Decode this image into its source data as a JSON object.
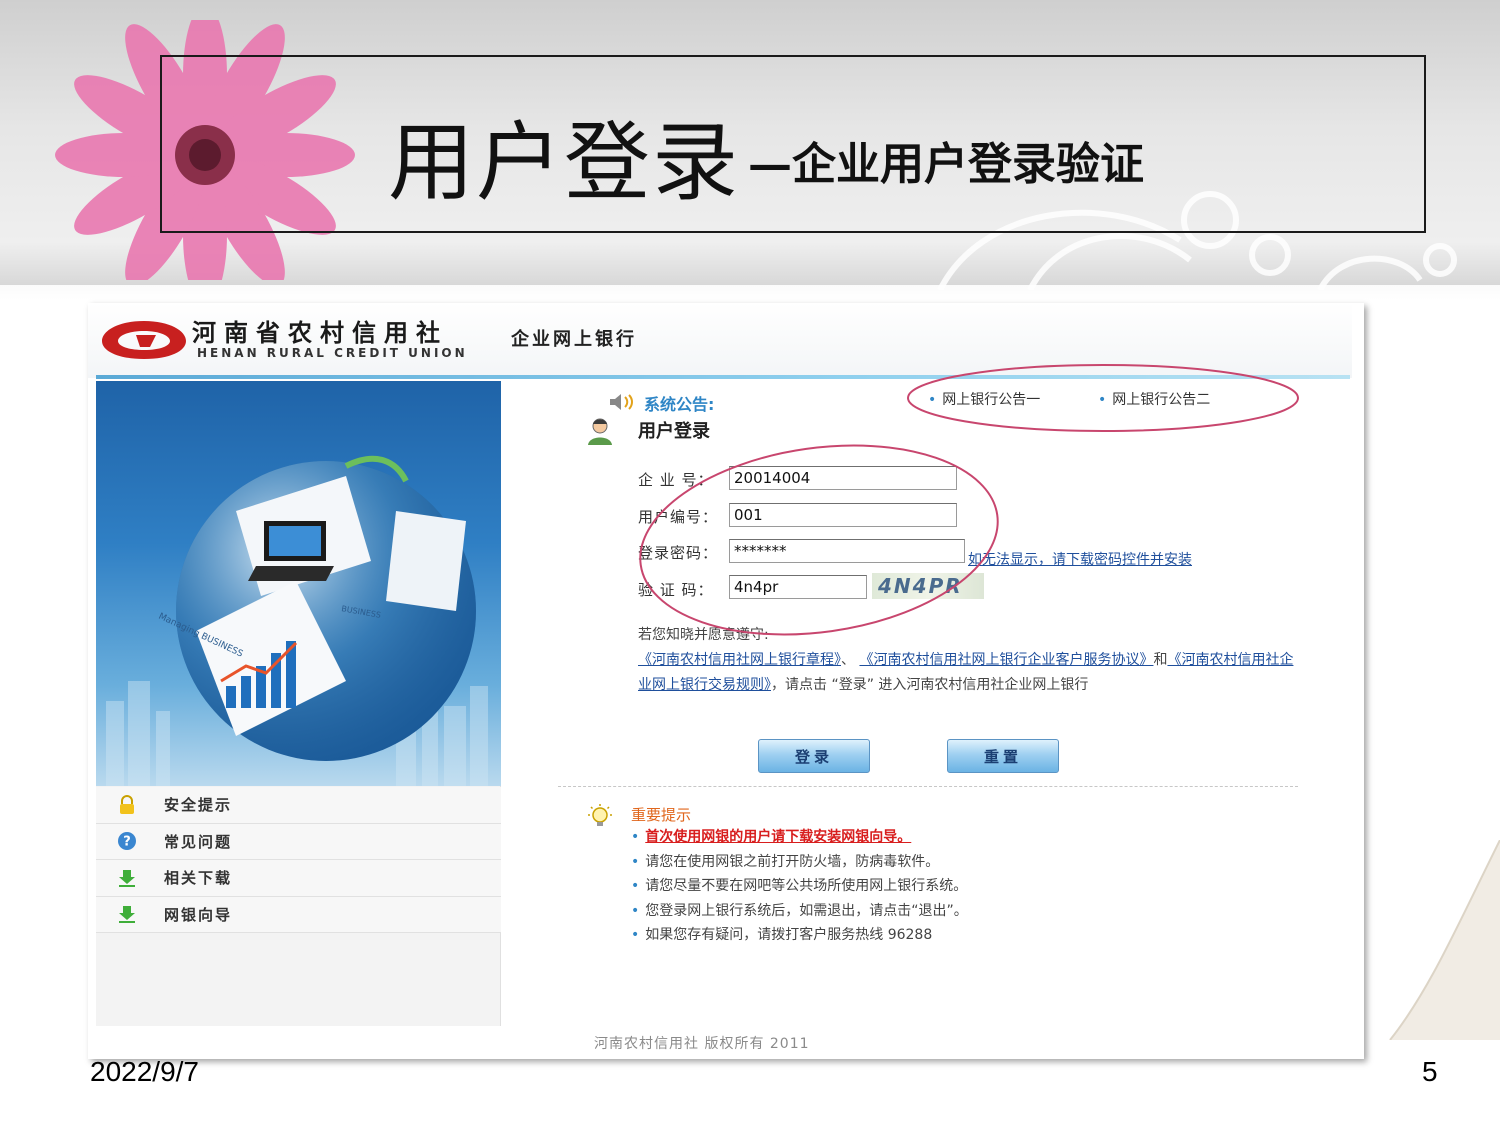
{
  "slide": {
    "title": "用户登录",
    "subtitle": "—企业用户登录验证",
    "date": "2022/9/7",
    "page_number": "5"
  },
  "bank": {
    "name_cn": "河南省农村信用社",
    "name_en": "HENAN RURAL CREDIT UNION",
    "product": "企业网上银行",
    "notice_label": "系统公告:",
    "notice_links": [
      "网上银行公告一",
      "网上银行公告二"
    ],
    "login_heading": "用户登录",
    "form": {
      "company_label": "企 业 号：",
      "company_value": "20014004",
      "user_label": "用户编号：",
      "user_value": "001",
      "password_label": "登录密码：",
      "password_value": "*******",
      "password_hint": "如无法显示，请下载密码控件并安装",
      "captcha_label": "验 证 码：",
      "captcha_value": "4n4pr",
      "captcha_image_text": "4N4PR"
    },
    "agreement": {
      "intro": "若您知晓并愿意遵守:",
      "link1": "《河南农村信用社网上银行章程》",
      "sep1": "、",
      "link2": "《河南农村信用社网上银行企业客户服务协议》",
      "and": "和",
      "link3": "《河南农村信用社企业网上银行交易规则》",
      "tail": "，请点击 “登录” 进入河南农村信用社企业网上银行"
    },
    "buttons": {
      "login": "登录",
      "reset": "重置"
    },
    "side_menu": [
      {
        "label": "安全提示",
        "icon": "lock-icon"
      },
      {
        "label": "常见问题",
        "icon": "help-icon"
      },
      {
        "label": "相关下载",
        "icon": "download-icon"
      },
      {
        "label": "网银向导",
        "icon": "download-icon"
      }
    ],
    "tips": {
      "title": "重要提示",
      "items": [
        "首次使用网银的用户请下载安装网银向导。",
        "请您在使用网银之前打开防火墙，防病毒软件。",
        "请您尽量不要在网吧等公共场所使用网上银行系统。",
        "您登录网上银行系统后，如需退出，请点击“退出”。",
        "如果您存有疑问，请拨打客户服务热线 96288"
      ]
    },
    "copyright": "河南农村信用社 版权所有 2011",
    "hero_text": [
      "Managing BUSINESS",
      "BUSINESS"
    ]
  },
  "colors": {
    "accent_blue": "#2f86c6",
    "link_blue": "#1f4f9c",
    "alert_red": "#d81e1e",
    "tip_orange": "#e0661c",
    "annotation_pink": "#c8466e",
    "logo_red": "#c8201f"
  }
}
